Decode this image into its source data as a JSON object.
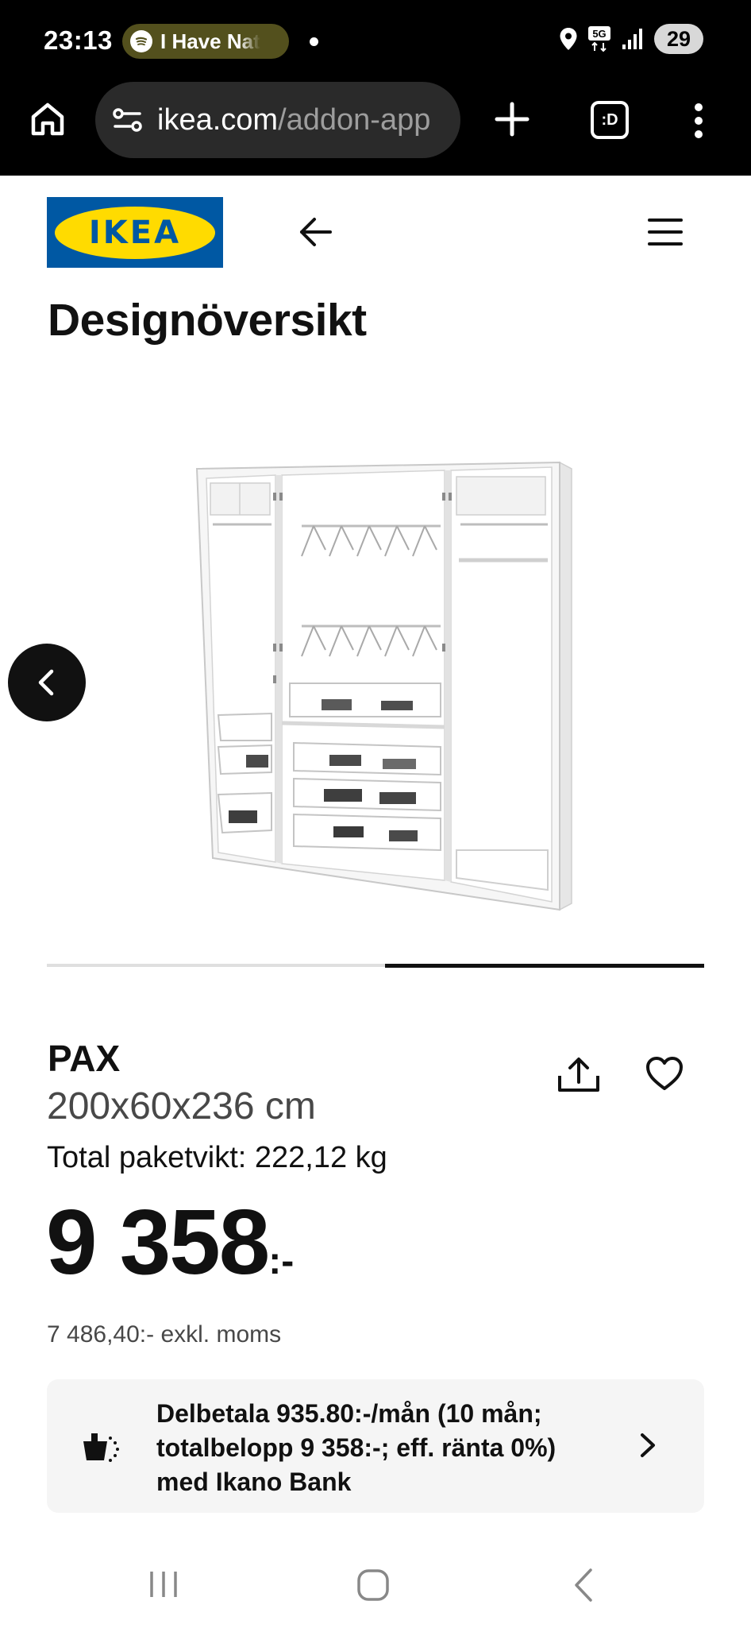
{
  "status_bar": {
    "time": "23:13",
    "media_pill_text": "I Have Nat",
    "media_app_icon": "spotify-icon",
    "battery": "29",
    "network": "5G"
  },
  "browser": {
    "url_domain": "ikea.com",
    "url_path": "/addon-app",
    "tab_label": ":D"
  },
  "header": {
    "logo_text": "IKEA",
    "page_title": "Designöversikt"
  },
  "carousel": {
    "image_alt": "PAX wardrobe",
    "progress_start": 0.515,
    "progress_end": 1.0
  },
  "product": {
    "name": "PAX",
    "dimensions": "200x60x236 cm",
    "weight": "Total paketvikt: 222,12 kg",
    "price_main": "9 358",
    "price_suffix": ":-",
    "price_excl_vat": "7 486,40:- exkl. moms"
  },
  "installment": {
    "text": "Delbetala 935.80:-/mån (10 mån; totalbelopp 9 358:-; eff. ränta 0%) med Ikano Bank"
  },
  "colors": {
    "ikea_blue": "#0058a3",
    "ikea_yellow": "#ffdb00",
    "pill_bg": "#53501d",
    "banner_bg": "#f5f5f5"
  }
}
